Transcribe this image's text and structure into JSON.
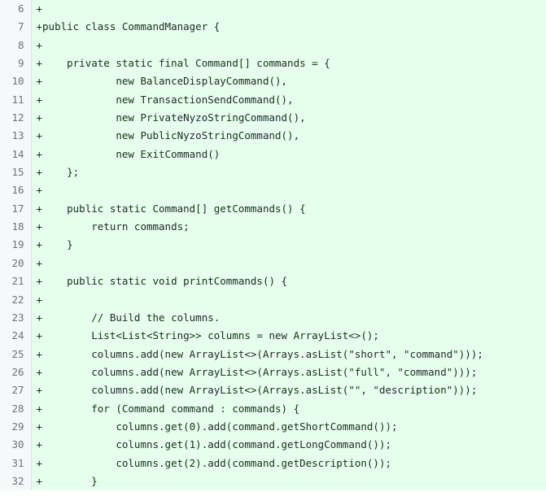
{
  "view": {
    "kind": "unified-diff",
    "language": "java",
    "colors": {
      "added_line_background": "#e6ffec",
      "gutter_background": "#f6f8fa",
      "gutter_border": "#e1e4e8",
      "line_number_text": "#6a737d",
      "code_text": "#24292e"
    }
  },
  "diff": {
    "rows": [
      {
        "number": "6",
        "marker": "+",
        "code": ""
      },
      {
        "number": "7",
        "marker": "+",
        "code": "public class CommandManager {"
      },
      {
        "number": "8",
        "marker": "+",
        "code": ""
      },
      {
        "number": "9",
        "marker": "+",
        "code": "    private static final Command[] commands = {"
      },
      {
        "number": "10",
        "marker": "+",
        "code": "            new BalanceDisplayCommand(),"
      },
      {
        "number": "11",
        "marker": "+",
        "code": "            new TransactionSendCommand(),"
      },
      {
        "number": "12",
        "marker": "+",
        "code": "            new PrivateNyzoStringCommand(),"
      },
      {
        "number": "13",
        "marker": "+",
        "code": "            new PublicNyzoStringCommand(),"
      },
      {
        "number": "14",
        "marker": "+",
        "code": "            new ExitCommand()"
      },
      {
        "number": "15",
        "marker": "+",
        "code": "    };"
      },
      {
        "number": "16",
        "marker": "+",
        "code": ""
      },
      {
        "number": "17",
        "marker": "+",
        "code": "    public static Command[] getCommands() {"
      },
      {
        "number": "18",
        "marker": "+",
        "code": "        return commands;"
      },
      {
        "number": "19",
        "marker": "+",
        "code": "    }"
      },
      {
        "number": "20",
        "marker": "+",
        "code": ""
      },
      {
        "number": "21",
        "marker": "+",
        "code": "    public static void printCommands() {"
      },
      {
        "number": "22",
        "marker": "+",
        "code": ""
      },
      {
        "number": "23",
        "marker": "+",
        "code": "        // Build the columns."
      },
      {
        "number": "24",
        "marker": "+",
        "code": "        List<List<String>> columns = new ArrayList<>();"
      },
      {
        "number": "25",
        "marker": "+",
        "code": "        columns.add(new ArrayList<>(Arrays.asList(\"short\", \"command\")));"
      },
      {
        "number": "26",
        "marker": "+",
        "code": "        columns.add(new ArrayList<>(Arrays.asList(\"full\", \"command\")));"
      },
      {
        "number": "27",
        "marker": "+",
        "code": "        columns.add(new ArrayList<>(Arrays.asList(\"\", \"description\")));"
      },
      {
        "number": "28",
        "marker": "+",
        "code": "        for (Command command : commands) {"
      },
      {
        "number": "29",
        "marker": "+",
        "code": "            columns.get(0).add(command.getShortCommand());"
      },
      {
        "number": "30",
        "marker": "+",
        "code": "            columns.get(1).add(command.getLongCommand());"
      },
      {
        "number": "31",
        "marker": "+",
        "code": "            columns.get(2).add(command.getDescription());"
      },
      {
        "number": "32",
        "marker": "+",
        "code": "        }"
      }
    ]
  }
}
